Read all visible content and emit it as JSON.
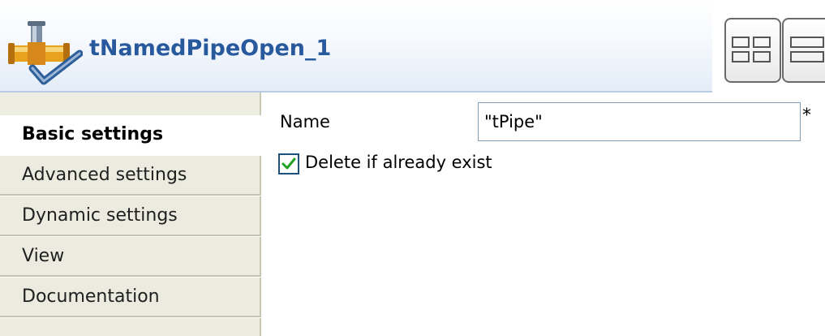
{
  "header": {
    "title": "tNamedPipeOpen_1",
    "icon": "named-pipe-component-icon",
    "layout_buttons": [
      "two-column-layout-icon",
      "single-column-layout-icon"
    ]
  },
  "tabs": [
    {
      "label": "Basic settings",
      "active": true
    },
    {
      "label": "Advanced settings",
      "active": false
    },
    {
      "label": "Dynamic settings",
      "active": false
    },
    {
      "label": "View",
      "active": false
    },
    {
      "label": "Documentation",
      "active": false
    }
  ],
  "form": {
    "name_label": "Name",
    "name_value": "\"tPipe\"",
    "required_marker": "*",
    "delete_label": "Delete if already exist",
    "delete_checked": true
  },
  "colors": {
    "title": "#28599d",
    "tab_background": "#ecebe0",
    "checkmark": "#21a121"
  }
}
